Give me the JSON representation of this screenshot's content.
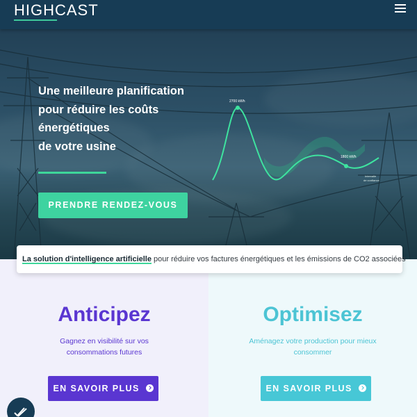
{
  "header": {
    "logo": "HIGHCAST",
    "menu_icon": "hamburger-menu-icon"
  },
  "hero": {
    "title_lines": [
      "Une meilleure planification",
      "pour réduire les coûts",
      "énergétiques",
      "de votre usine"
    ],
    "cta_label": "PRENDRE RENDEZ-VOUS",
    "chart": {
      "point1_label": "2700 kWh",
      "point2_label": "1800 kWh",
      "confidence_line1": "Intervalle",
      "confidence_line2": "de confiance"
    }
  },
  "tagline": {
    "highlight": "La solution d'intelligence artificielle",
    "rest": " pour réduire vos factures énergétiques et les émissions de CO2 associées"
  },
  "panels": {
    "left": {
      "title": "Anticipez",
      "description": "Gagnez en visibilité sur vos consommations futures",
      "button": "EN SAVOIR PLUS",
      "button_icon": "arrow-circle-right-icon",
      "color": "#5a36d1"
    },
    "right": {
      "title": "Optimisez",
      "description": "Aménagez votre production pour mieux consommer",
      "button": "EN SAVOIR PLUS",
      "button_icon": "arrow-circle-right-icon",
      "color": "#47c7d6"
    }
  },
  "colors": {
    "header_bg": "#173c55",
    "accent_green": "#3ed3a0"
  },
  "chat_badge_icon": "chat-check-icon"
}
